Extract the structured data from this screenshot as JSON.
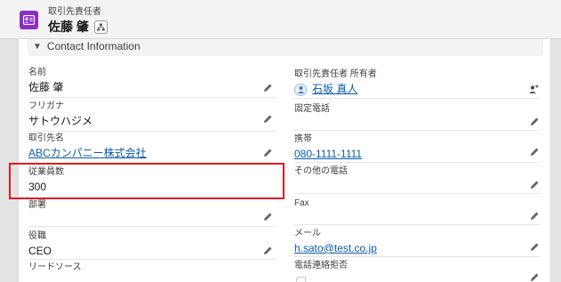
{
  "header": {
    "object_type": "取引先責任者",
    "record_name": "佐藤 肇"
  },
  "section": {
    "title": "Contact Information"
  },
  "left": {
    "name": {
      "label": "名前",
      "value": "佐藤 肇"
    },
    "furigana": {
      "label": "フリガナ",
      "value": "サトウハジメ"
    },
    "account": {
      "label": "取引先名",
      "value": "ABCカンパニー株式会社"
    },
    "employees": {
      "label": "従業員数",
      "value": "300"
    },
    "department": {
      "label": "部署",
      "value": ""
    },
    "title": {
      "label": "役職",
      "value": "CEO"
    },
    "lead_source": {
      "label": "リードソース",
      "value": ""
    }
  },
  "right": {
    "owner": {
      "label": "取引先責任者 所有者",
      "value": "石坂 真人"
    },
    "phone": {
      "label": "固定電話",
      "value": ""
    },
    "mobile": {
      "label": "携帯",
      "value": "080-1111-1111"
    },
    "other_phone": {
      "label": "その他の電話",
      "value": ""
    },
    "fax": {
      "label": "Fax",
      "value": ""
    },
    "email": {
      "label": "メール",
      "value": "h.sato@test.co.jp"
    },
    "do_not_call": {
      "label": "電話連絡拒否",
      "value": ""
    }
  },
  "colors": {
    "brand_icon": "#8c2ec8",
    "link": "#0b5cab",
    "highlight": "#e11b22"
  },
  "icons": [
    "contact-card-icon",
    "hierarchy-icon",
    "pencil-icon",
    "change-owner-icon",
    "user-avatar-icon",
    "chevron-down-icon"
  ]
}
